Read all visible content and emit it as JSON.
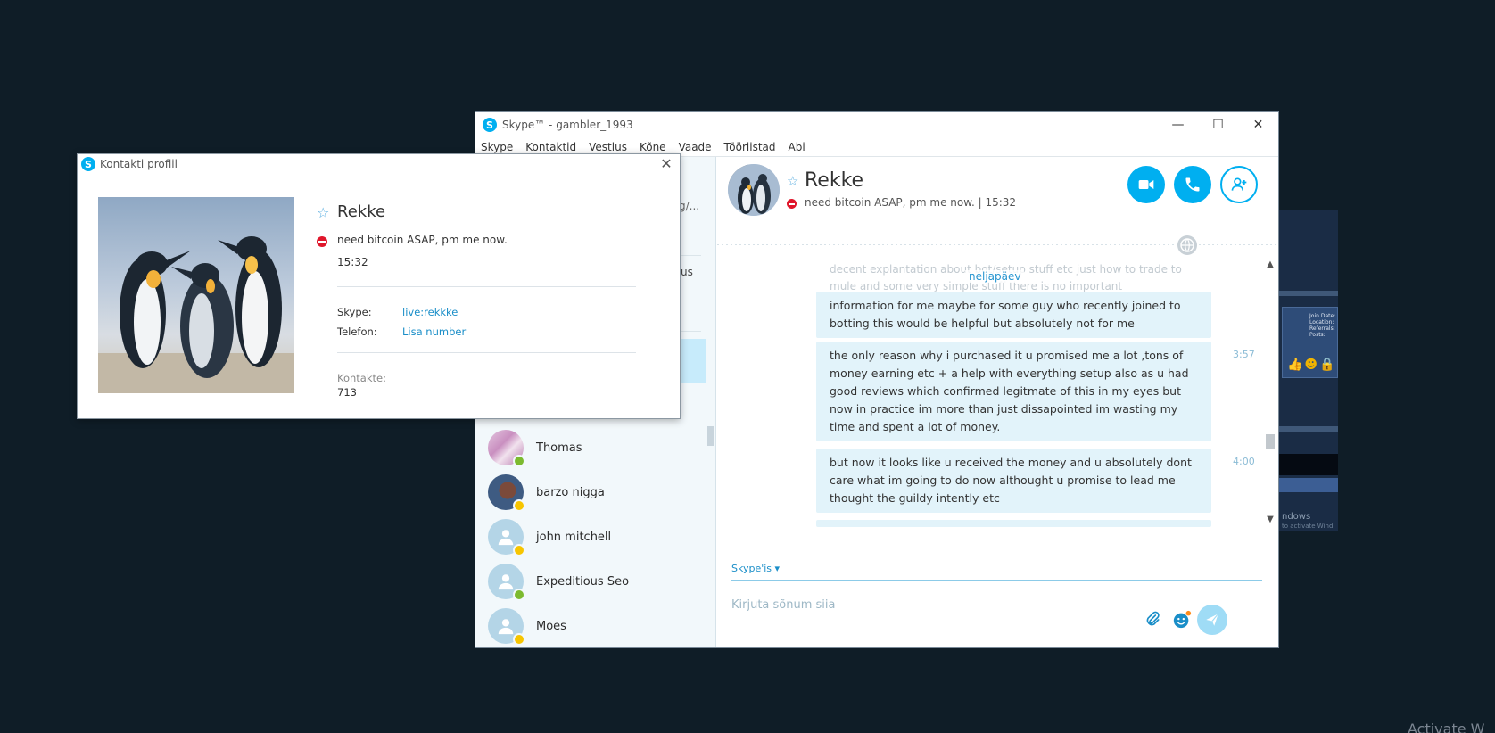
{
  "main_window": {
    "title": "Skype™ - gambler_1993",
    "menu": [
      "Skype",
      "Kontaktid",
      "Vestlus",
      "Kõne",
      "Vaade",
      "Tööriistad",
      "Abi"
    ]
  },
  "sidebar": {
    "partial_text_1": "g/...",
    "partial_text_2": "us",
    "contacts": [
      {
        "name": "Thomas",
        "status": "online"
      },
      {
        "name": "barzo nigga",
        "status": "away"
      },
      {
        "name": "john mitchell",
        "status": "away"
      },
      {
        "name": "Expeditious Seo",
        "status": "online"
      },
      {
        "name": "Moes",
        "status": "away"
      }
    ]
  },
  "chat": {
    "contact_name": "Rekke",
    "mood": "need bitcoin ASAP, pm me now.",
    "time": "15:32",
    "day_label": "neljapäev",
    "faded_text": "decent explantation about bot/setup stuff etc just how to trade to mule and some very simple stuff there is no important",
    "messages": [
      {
        "text": "information for me maybe for some guy who recently joined to botting this would be helpful but absolutely not for me",
        "time": ""
      },
      {
        "text": "the only reason why i purchased it u promised me a lot ,tons of money earning etc + a help with everything setup also as u had good reviews which confirmed legitmate of this in my eyes but now in practice im more than just dissapointed im wasting my time and spent a lot of money.",
        "time": "3:57"
      },
      {
        "text": "but now it looks like u received the money and u absolutely dont care what im going to do now althought u promise to lead me thought the guildy intently etc",
        "time": "4:00"
      }
    ],
    "compose_via": "Skype'is",
    "compose_placeholder": "Kirjuta sõnum siia"
  },
  "profile_dialog": {
    "title": "Kontakti profiil",
    "name": "Rekke",
    "mood": "need bitcoin ASAP, pm me now.",
    "time": "15:32",
    "skype_label": "Skype:",
    "skype_value": "live:rekkke",
    "phone_label": "Telefon:",
    "phone_value": "Lisa number",
    "contacts_label": "Kontakte:",
    "contacts_value": "713"
  },
  "background": {
    "watermark": "Activate W",
    "window_text": "ndows",
    "window_subtext": "to activate Wind",
    "panel_lines": [
      "Join Date:",
      "Location:",
      "Referrals:",
      "Posts:"
    ]
  },
  "colors": {
    "accent": "#00aff0",
    "desktop": "#0f1d27",
    "bubble": "#e2f3fa",
    "dnd": "#e0162b",
    "online": "#7cba2f",
    "away": "#f7c500"
  }
}
